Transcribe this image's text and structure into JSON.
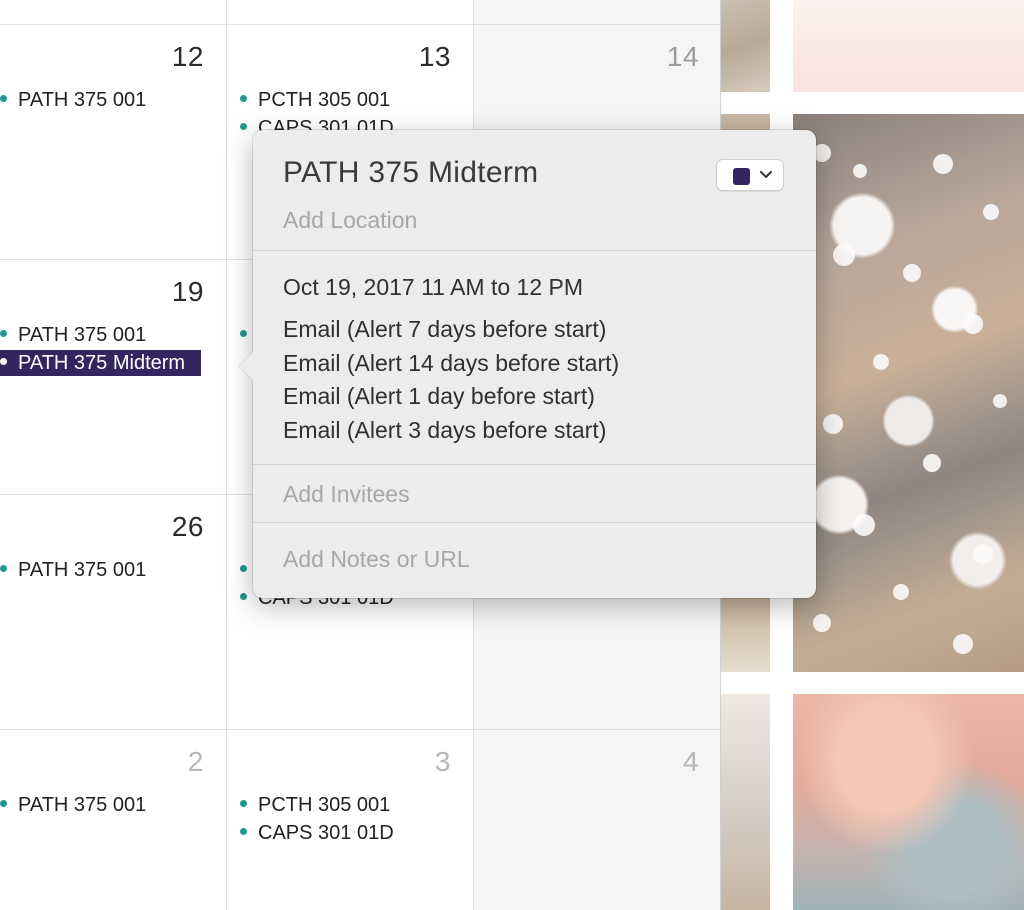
{
  "calendar": {
    "rows": [
      {
        "cells": [
          {
            "day": "12",
            "events": [
              "PATH 375 001"
            ]
          },
          {
            "day": "13",
            "events": [
              "PCTH 305 001",
              "CAPS 301 01D"
            ]
          },
          {
            "day": "14",
            "events": []
          }
        ]
      },
      {
        "cells": [
          {
            "day": "19",
            "events": [
              "PATH 375 001",
              "PATH 375 Midterm"
            ]
          },
          {
            "day": "",
            "events": []
          },
          {
            "day": "",
            "events": []
          }
        ]
      },
      {
        "cells": [
          {
            "day": "26",
            "events": [
              "PATH 375 001"
            ]
          },
          {
            "day": "",
            "events": [
              "",
              "CAPS 301 01D"
            ]
          },
          {
            "day": "",
            "events": []
          }
        ]
      },
      {
        "cells": [
          {
            "day": "2",
            "events": [
              "PATH 375 001"
            ]
          },
          {
            "day": "3",
            "events": [
              "PCTH 305 001",
              "CAPS 301 01D"
            ]
          },
          {
            "day": "4",
            "events": []
          }
        ]
      }
    ],
    "event_dot_color": "#1e9a8a",
    "selected_event_color": "#33265e"
  },
  "popover": {
    "title": "PATH 375 Midterm",
    "location_placeholder": "Add Location",
    "datetime": "Oct 19, 2017  11 AM to 12 PM",
    "alerts": [
      "Email (Alert 7 days before start)",
      "Email (Alert 14 days before start)",
      "Email (Alert 1 day before start)",
      "Email (Alert 3 days before start)"
    ],
    "invitees_placeholder": "Add Invitees",
    "notes_placeholder": "Add Notes or URL",
    "calendar_color": "#33265e",
    "color_picker_icon": "chevron-down-icon"
  }
}
